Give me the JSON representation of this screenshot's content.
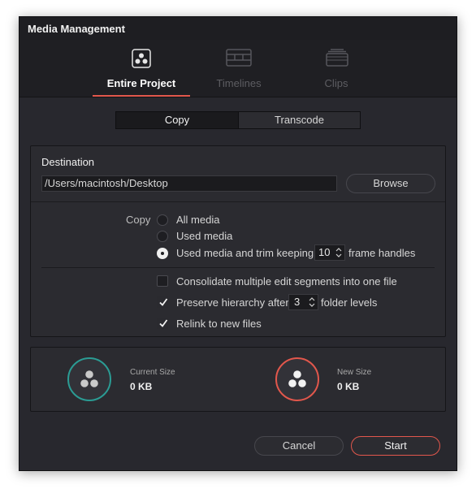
{
  "window": {
    "title": "Media Management"
  },
  "tabs": [
    {
      "label": "Entire Project",
      "icon": "project-icon",
      "active": true
    },
    {
      "label": "Timelines",
      "icon": "timeline-icon",
      "active": false
    },
    {
      "label": "Clips",
      "icon": "clips-icon",
      "active": false
    }
  ],
  "mode": {
    "copy_label": "Copy",
    "transcode_label": "Transcode",
    "selected": "Copy"
  },
  "destination": {
    "label": "Destination",
    "path": "/Users/macintosh/Desktop",
    "browse_label": "Browse"
  },
  "copy_options": {
    "label": "Copy",
    "all_media": "All media",
    "used_media": "Used media",
    "trim_prefix": "Used media and trim keeping",
    "trim_value": "10",
    "trim_suffix": "frame handles",
    "selected": "trim"
  },
  "options": {
    "consolidate": {
      "label": "Consolidate multiple edit segments into one file",
      "checked": false
    },
    "preserve": {
      "prefix": "Preserve hierarchy after",
      "value": "3",
      "suffix": "folder levels",
      "checked": true
    },
    "relink": {
      "label": "Relink to new files",
      "checked": true
    }
  },
  "sizes": {
    "current": {
      "caption": "Current Size",
      "value": "0 KB"
    },
    "new": {
      "caption": "New Size",
      "value": "0 KB"
    }
  },
  "buttons": {
    "cancel": "Cancel",
    "start": "Start"
  },
  "colors": {
    "accent": "#e2574c",
    "teal": "#2b9c94",
    "background": "#28282e"
  }
}
